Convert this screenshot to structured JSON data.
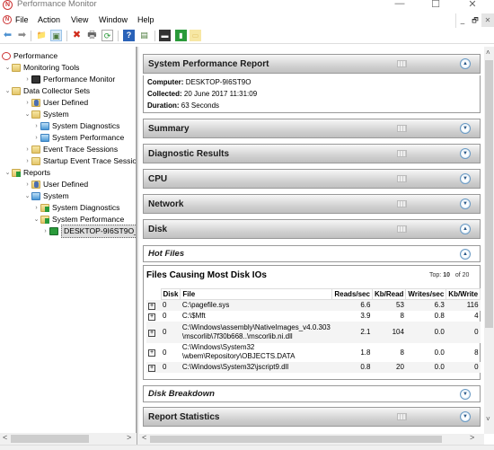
{
  "window": {
    "title": "Performance Monitor",
    "minimize": "—",
    "maximize": "☐",
    "close": "✕"
  },
  "menu": {
    "items": [
      "File",
      "Action",
      "View",
      "Window",
      "Help"
    ],
    "mdi": {
      "minimize": "_",
      "restore": "🗗",
      "close": "✕"
    }
  },
  "toolbar": {
    "buttons": [
      {
        "name": "back",
        "glyph": "⬅"
      },
      {
        "name": "forward",
        "glyph": "➡"
      },
      {
        "name": "up-folder",
        "glyph": "📁"
      },
      {
        "name": "show-hide-console-tree",
        "glyph": "▣"
      },
      {
        "name": "delete",
        "glyph": "✖"
      },
      {
        "name": "print",
        "glyph": "🖶"
      },
      {
        "name": "refresh",
        "glyph": "⟳"
      },
      {
        "name": "help",
        "glyph": "?"
      },
      {
        "name": "show-hide-action-pane",
        "glyph": "▤"
      },
      {
        "name": "performance-monitor",
        "glyph": "▬"
      },
      {
        "name": "report",
        "glyph": "▮"
      },
      {
        "name": "new-folder",
        "glyph": "▭"
      }
    ]
  },
  "tree": {
    "items": [
      {
        "label": "Performance",
        "level": 0,
        "chevron": "",
        "icon": "perf"
      },
      {
        "label": "Monitoring Tools",
        "level": 1,
        "chevron": "⌄",
        "icon": "folder"
      },
      {
        "label": "Performance Monitor",
        "level": 2,
        "chevron": "›",
        "icon": "monitor"
      },
      {
        "label": "Data Collector Sets",
        "level": 1,
        "chevron": "⌄",
        "icon": "folder"
      },
      {
        "label": "User Defined",
        "level": 2,
        "chevron": "›",
        "icon": "user"
      },
      {
        "label": "System",
        "level": 2,
        "chevron": "⌄",
        "icon": "folder"
      },
      {
        "label": "System Diagnostics",
        "level": 3,
        "chevron": "›",
        "icon": "sysblue"
      },
      {
        "label": "System Performance",
        "level": 3,
        "chevron": "›",
        "icon": "sysblue"
      },
      {
        "label": "Event Trace Sessions",
        "level": 2,
        "chevron": "›",
        "icon": "folder"
      },
      {
        "label": "Startup Event Trace Session",
        "level": 2,
        "chevron": "›",
        "icon": "folder"
      },
      {
        "label": "Reports",
        "level": 1,
        "chevron": "⌄",
        "icon": "folder-green"
      },
      {
        "label": "User Defined",
        "level": 2,
        "chevron": "›",
        "icon": "user"
      },
      {
        "label": "System",
        "level": 2,
        "chevron": "⌄",
        "icon": "sysblue"
      },
      {
        "label": "System Diagnostics",
        "level": 3,
        "chevron": "›",
        "icon": "folder-green"
      },
      {
        "label": "System Performance",
        "level": 3,
        "chevron": "⌄",
        "icon": "folder-green"
      },
      {
        "label": "DESKTOP-9I6ST9O_",
        "level": 4,
        "chevron": "›",
        "icon": "report",
        "selected": true
      }
    ]
  },
  "report": {
    "title": "System Performance Report",
    "computer_label": "Computer:",
    "computer": "DESKTOP-9I6ST9O",
    "collected_label": "Collected:",
    "collected": "20 June 2017 11:31:09",
    "duration_label": "Duration:",
    "duration": "63 Seconds",
    "sections": [
      {
        "title": "Summary",
        "expanded": false
      },
      {
        "title": "Diagnostic Results",
        "expanded": false
      },
      {
        "title": "CPU",
        "expanded": false
      },
      {
        "title": "Network",
        "expanded": false
      },
      {
        "title": "Disk",
        "expanded": true
      }
    ],
    "hot_files": {
      "title": "Hot Files",
      "table_title": "Files Causing Most Disk IOs",
      "top_label": "Top:",
      "top_value": "10",
      "of_label": "of",
      "of_value": "20",
      "columns": [
        "",
        "Disk",
        "File",
        "Reads/sec",
        "Kb/Read",
        "Writes/sec",
        "Kb/Write"
      ],
      "rows": [
        {
          "disk": "0",
          "file": "C:\\pagefile.sys",
          "reads": "6.6",
          "kbread": "53",
          "writes": "6.3",
          "kbwrite": "116"
        },
        {
          "disk": "0",
          "file": "C:\\$Mft",
          "reads": "3.9",
          "kbread": "8",
          "writes": "0.8",
          "kbwrite": "4"
        },
        {
          "disk": "0",
          "file": "C:\\Windows\\assembly\\NativeImages_v4.0.303\n\\mscorlib\\7f30b668..\\mscorlib.ni.dll",
          "reads": "2.1",
          "kbread": "104",
          "writes": "0.0",
          "kbwrite": "0"
        },
        {
          "disk": "0",
          "file": "C:\\Windows\\System32\n\\wbem\\Repository\\OBJECTS.DATA",
          "reads": "1.8",
          "kbread": "8",
          "writes": "0.0",
          "kbwrite": "8"
        },
        {
          "disk": "0",
          "file": "C:\\Windows\\System32\\jscript9.dll",
          "reads": "0.8",
          "kbread": "20",
          "writes": "0.0",
          "kbwrite": "0"
        }
      ]
    },
    "disk_breakdown": "Disk Breakdown",
    "report_statistics": "Report Statistics"
  },
  "icons": {
    "expand": "⊞",
    "collapse_up": "▲",
    "expand_down": "▼",
    "scroll_up": "˄",
    "scroll_down": "˅",
    "scroll_left": "<",
    "scroll_right": ">"
  }
}
